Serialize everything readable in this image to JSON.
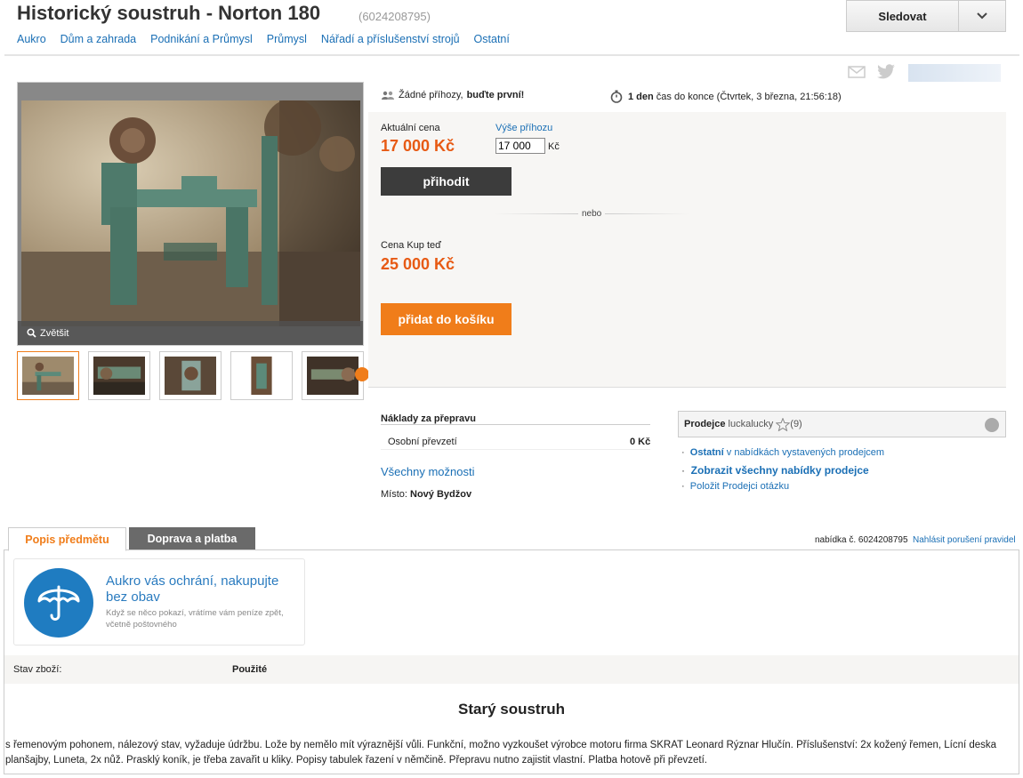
{
  "header": {
    "title": "Historický soustruh - Norton 180",
    "item_id": "(6024208795)",
    "follow_label": "Sledovat",
    "breadcrumbs": [
      "Aukro",
      "Dům a zahrada",
      "Podnikání a Průmysl",
      "Průmysl",
      "Nářadí a příslušenství strojů",
      "Ostatní"
    ]
  },
  "gallery": {
    "zoom_label": "Zvětšit",
    "thumb_count": 5
  },
  "auction": {
    "bids_text": "Žádné příhozy,",
    "bids_cta": "buďte první!",
    "time_bold": "1 den",
    "time_text": "čas do konce (Čtvrtek, 3 března, 21:56:18)",
    "current_price_label": "Aktuální cena",
    "current_price": "17 000 Kč",
    "bid_label": "Výše příhozu",
    "bid_value": "17 000",
    "bid_currency": "Kč",
    "bid_button": "přihodit",
    "or_text": "nebo",
    "buynow_label": "Cena Kup teď",
    "buynow_price": "25 000 Kč",
    "cart_button": "přidat do košíku"
  },
  "shipping": {
    "title": "Náklady za přepravu",
    "option_name": "Osobní převzetí",
    "option_price": "0 Kč",
    "all_options": "Všechny možnosti",
    "location_label": "Místo:",
    "location_value": "Nový Bydžov"
  },
  "seller": {
    "label": "Prodejce",
    "name": "luckalucky",
    "rating": "(9)",
    "link1_bold": "Ostatní",
    "link1_rest": "v nabídkách vystavených prodejcem",
    "link2": "Zobrazit všechny nabídky prodejce",
    "link3": "Položit Prodejci otázku"
  },
  "tabs": {
    "description": "Popis předmětu",
    "shipping": "Doprava a platba",
    "offer_number": "nabídka č. 6024208795",
    "report": "Nahlásit porušení pravidel"
  },
  "protection": {
    "title": "Aukro vás ochrání, nakupujte bez obav",
    "subtitle": "Když se něco pokazí, vrátíme vám peníze zpět, včetně poštovného"
  },
  "item": {
    "condition_label": "Stav zboží:",
    "condition_value": "Použité",
    "heading": "Starý soustruh",
    "text": "s řemenovým pohonem, nálezový stav, vyžaduje údržbu. Lože by nemělo mít výraznější vůli. Funkční, možno vyzkoušet výrobce motoru firma SKRAT Leonard Rýznar Hlučín. Příslušenství: 2x kožený řemen, Lícní deska planšajby, Luneta, 2x nůž. Prasklý koník, je třeba zavařit u kliky. Popisy tabulek řazení v němčině. Přepravu nutno zajistit vlastní. Platba hotově při převzetí."
  },
  "colors": {
    "accent": "#f07d1a",
    "price": "#e75a14",
    "link": "#1a6fb5"
  }
}
